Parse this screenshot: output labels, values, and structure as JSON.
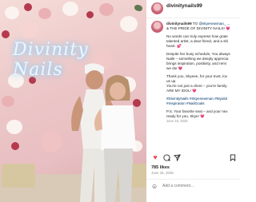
{
  "post": {
    "username": "divinitynails99",
    "neon_sign": "Divinity Nails",
    "caption_lines": [
      {
        "user": "divinitynails99",
        "text": " TO ",
        "link": "@skyenewman_",
        "tail": " ..."
      },
      {
        "text": "& THE PRIDE OF DIVINITY NAILS! 💗"
      },
      {
        "text": "No words can truly express how grate"
      },
      {
        "text": "talented artist, a dear friend, and a shi"
      },
      {
        "text": "heart. 💕"
      },
      {
        "text": "Despite her busy schedule, You always"
      },
      {
        "text": "Nails – something we deeply apprecia"
      },
      {
        "text": "brings inspiration, positivity, and remi"
      },
      {
        "text": "we do! 💗"
      },
      {
        "text": "Thank you, Skyeee, for your trust, lov"
      },
      {
        "text": "us up."
      },
      {
        "text": "You're not just a client – you're family."
      },
      {
        "text": "ARE MY IDOL! 💗"
      },
      {
        "text": "#DivinityNails #Skyenewman #Myidol"
      },
      {
        "text": "#Inspiration #NailGoals"
      },
      {
        "text": "P.S. Your favorite seat – and your nex"
      },
      {
        "text": "ready for you, Skye! 💗"
      }
    ],
    "caption_date": "June 16, 2025",
    "likes": "785 likes",
    "date": "June 16, 2025",
    "comment_placeholder": "Add a comment...",
    "icons": {
      "like": "heart-icon",
      "comment": "comment-icon",
      "share": "share-icon",
      "save": "bookmark-icon",
      "emoji": "emoji-icon"
    },
    "colors": {
      "heart": "#ed4956",
      "link": "#00376b"
    }
  }
}
